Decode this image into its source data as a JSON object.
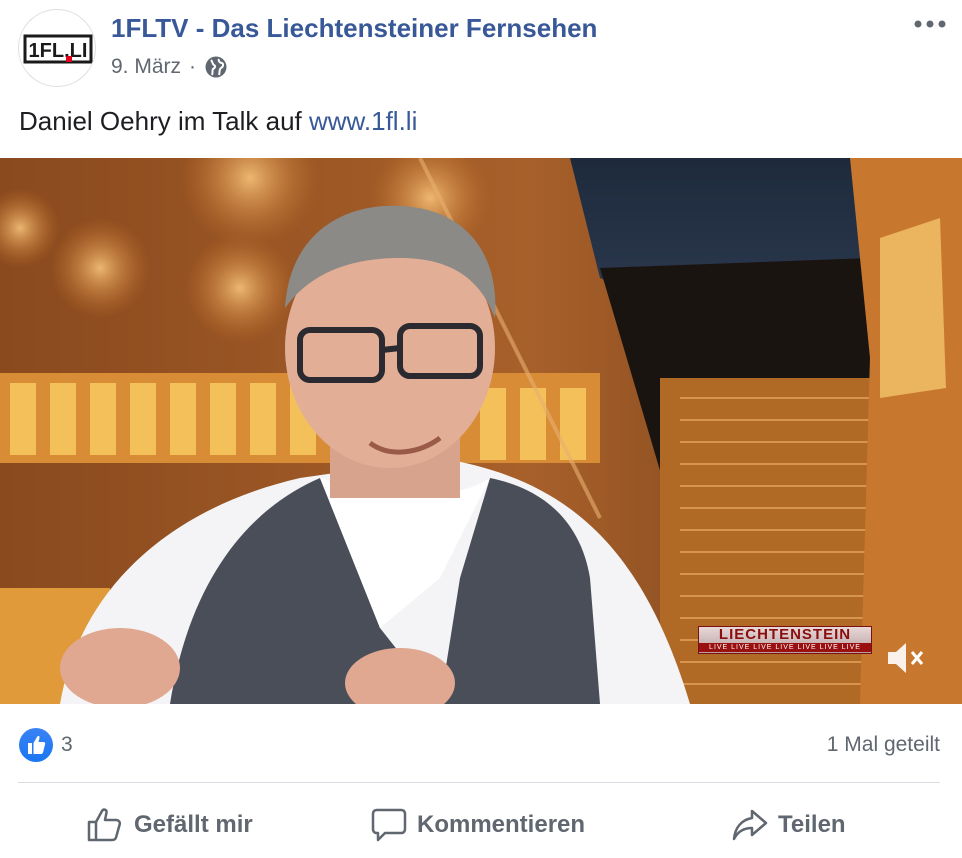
{
  "post": {
    "page_name": "1FLTV - Das Liechtensteiner Fernsehen",
    "date": "9. März",
    "separator": "·",
    "privacy_icon": "globe-icon",
    "more_icon": "more-horizontal-icon",
    "avatar_text": "1FL.LI",
    "caption_text": "Daniel Oehry im Talk auf ",
    "caption_link": "www.1fl.li"
  },
  "video": {
    "overlay_title": "LIECHTENSTEIN",
    "overlay_ticker": "LIVE LIVE LIVE LIVE LIVE LIVE LIVE",
    "mute_icon": "speaker-muted-icon"
  },
  "stats": {
    "like_count": "3",
    "shares": "1 Mal geteilt"
  },
  "actions": {
    "like": "Gefällt mir",
    "comment": "Kommentieren",
    "share": "Teilen"
  },
  "colors": {
    "link": "#385898",
    "secondary_text": "#606770",
    "like_blue": "#1877f2"
  }
}
